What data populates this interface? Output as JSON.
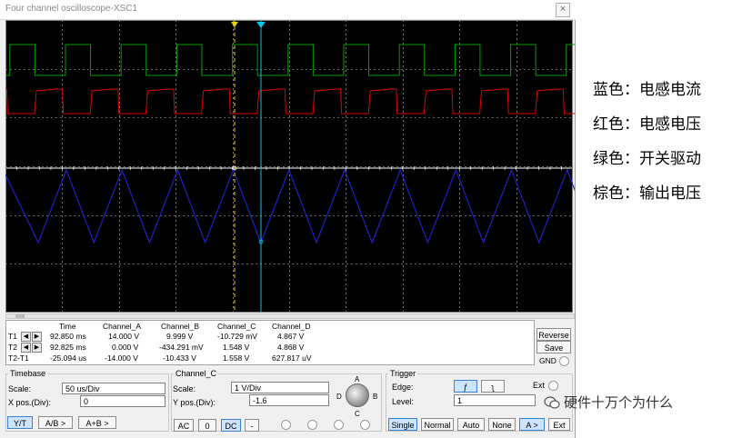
{
  "window": {
    "title": "Four channel oscilloscope-XSC1",
    "close_glyph": "×"
  },
  "readout": {
    "headers": [
      "Time",
      "Channel_A",
      "Channel_B",
      "Channel_C",
      "Channel_D"
    ],
    "rows": [
      {
        "label": "T1",
        "time": "92.850 ms",
        "a": "14.000 V",
        "b": "9.999 V",
        "c": "-10.729 mV",
        "d": "4.867 V"
      },
      {
        "label": "T2",
        "time": "92.825 ms",
        "a": "0.000 V",
        "b": "-434.291 mV",
        "c": "1.548 V",
        "d": "4.868 V"
      },
      {
        "label": "T2-T1",
        "time": "-25.094 us",
        "a": "-14.000 V",
        "b": "-10.433 V",
        "c": "1.558 V",
        "d": "627.817 uV"
      }
    ],
    "reverse_label": "Reverse",
    "save_label": "Save",
    "gnd_label": "GND"
  },
  "timebase": {
    "title": "Timebase",
    "scale_label": "Scale:",
    "scale_value": "50 us/Div",
    "xpos_label": "X pos.(Div):",
    "xpos_value": "0",
    "modes": [
      "Y/T",
      "A/B >",
      "A+B >"
    ]
  },
  "channel": {
    "title": "Channel_C",
    "scale_label": "Scale:",
    "scale_value": "1  V/Div",
    "ypos_label": "Y pos.(Div):",
    "ypos_value": "-1.6",
    "coupling": [
      "AC",
      "0",
      "DC",
      "-"
    ],
    "knob_labels": {
      "a": "A",
      "b": "B",
      "c": "C",
      "d": "D"
    }
  },
  "trigger": {
    "title": "Trigger",
    "edge_label": "Edge:",
    "level_label": "Level:",
    "level_value": "1",
    "ext_label": "Ext",
    "modes": [
      "Single",
      "Normal",
      "Auto",
      "None",
      "A >",
      "Ext"
    ]
  },
  "legend": [
    {
      "text": "蓝色：电感电流"
    },
    {
      "text": "红色：电感电压"
    },
    {
      "text": "绿色：开关驱动"
    },
    {
      "text": "棕色：输出电压"
    }
  ],
  "watermark": "硬件十万个为什么",
  "colors": {
    "green_trace": "#00a000",
    "red_trace": "#e00000",
    "blue_trace": "#2020c0",
    "brown_trace": "#ffffff",
    "cursor1": "#e6d200",
    "cursor2": "#00c8e6",
    "grid": "#c8c8c8",
    "screen_bg": "#000000"
  }
}
